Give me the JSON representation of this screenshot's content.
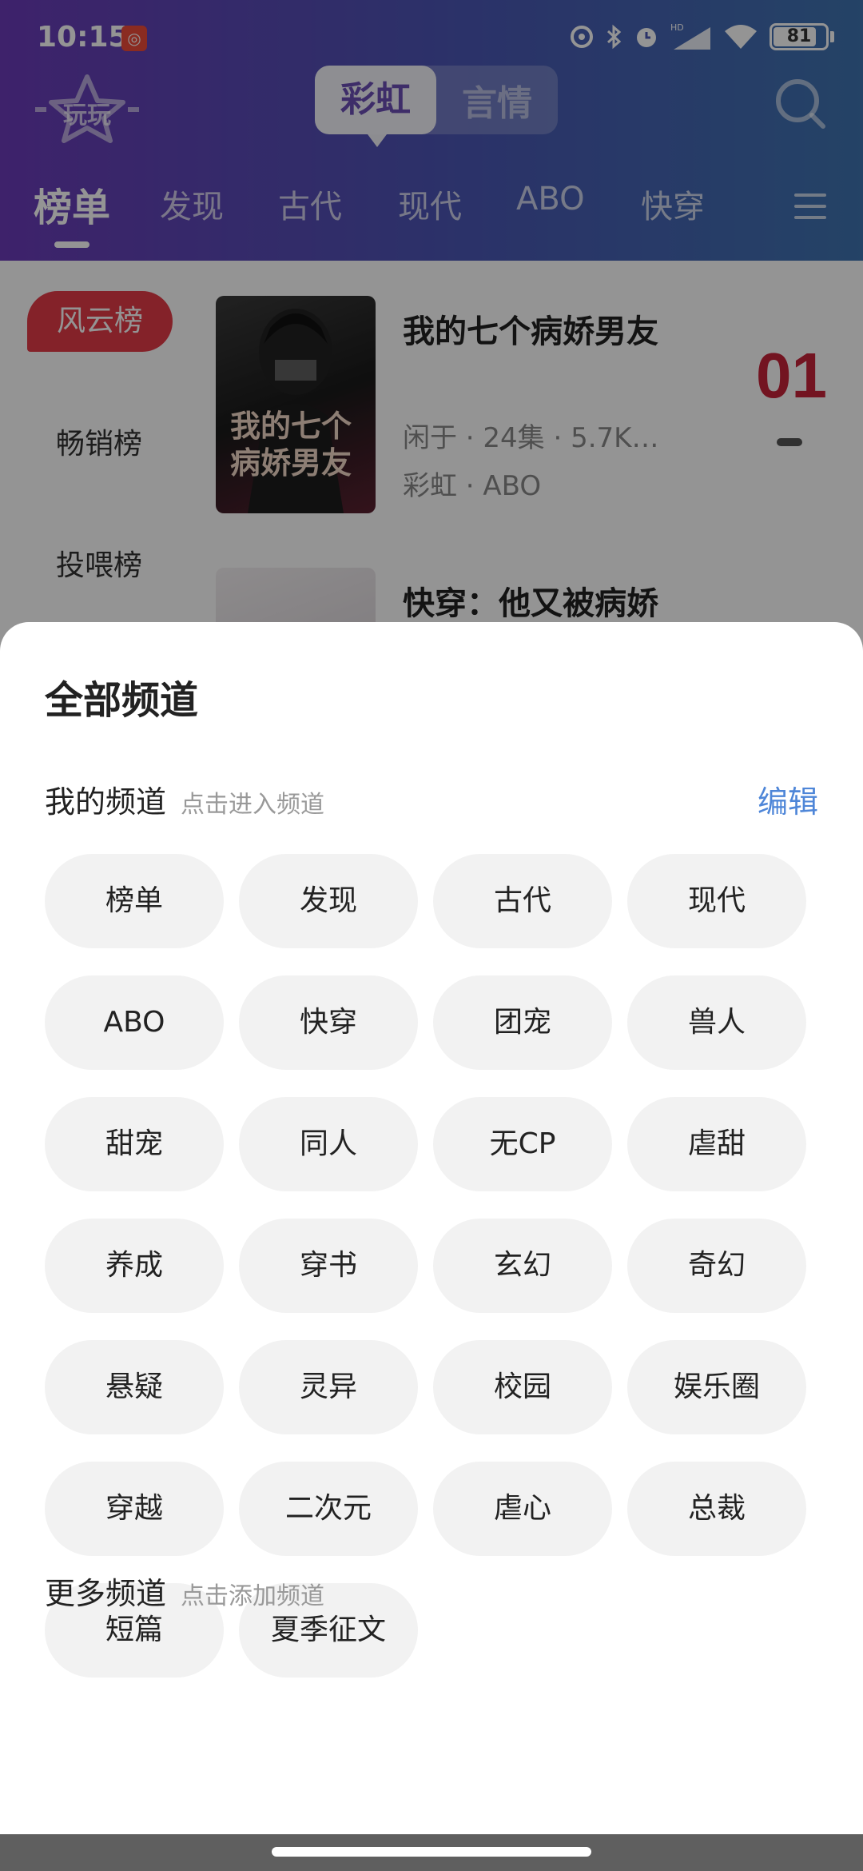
{
  "status_bar": {
    "time": "10:15",
    "notification_icon": "netease-music-icon",
    "battery_level": "81",
    "icons": [
      "nfc-icon",
      "bluetooth-icon",
      "alarm-icon",
      "hd-signal-icon",
      "wifi-icon"
    ]
  },
  "header": {
    "logo_icon": "wanwan-logo-icon",
    "mode_tabs": [
      {
        "label": "彩虹",
        "active": true
      },
      {
        "label": "言情",
        "active": false
      }
    ],
    "search_icon": "search-icon"
  },
  "category_tabs": [
    {
      "label": "榜单",
      "active": true
    },
    {
      "label": "发现"
    },
    {
      "label": "古代"
    },
    {
      "label": "现代"
    },
    {
      "label": "ABO"
    },
    {
      "label": "快穿"
    }
  ],
  "rank_sidebar": [
    {
      "label": "风云榜",
      "active": true
    },
    {
      "label": "畅销榜"
    },
    {
      "label": "投喂榜"
    }
  ],
  "books": [
    {
      "title": "我的七个病娇男友",
      "cover_text_line1": "我的七个",
      "cover_text_line2": "病娇男友",
      "meta": "闲于 · 24集 · 5.7K…",
      "tags": "彩虹 · ABO",
      "rank": "01"
    },
    {
      "title": "快穿：他又被病娇"
    }
  ],
  "sheet": {
    "title": "全部频道",
    "my_channels_title": "我的频道",
    "my_channels_hint": "点击进入频道",
    "edit_label": "编辑",
    "channels": [
      "榜单",
      "发现",
      "古代",
      "现代",
      "ABO",
      "快穿",
      "团宠",
      "兽人",
      "甜宠",
      "同人",
      "无CP",
      "虐甜",
      "养成",
      "穿书",
      "玄幻",
      "奇幻",
      "悬疑",
      "灵异",
      "校园",
      "娱乐圈",
      "穿越",
      "二次元",
      "虐心",
      "总裁",
      "短篇",
      "夏季征文"
    ],
    "more_channels_title": "更多频道",
    "more_channels_hint": "点击添加频道"
  },
  "colors": {
    "header_gradient_start": "#6b3bb8",
    "header_gradient_end": "#3f74b0",
    "rank_active": "#e33b48",
    "edit_link": "#4e86d8",
    "chip_bg": "#f2f2f2"
  }
}
